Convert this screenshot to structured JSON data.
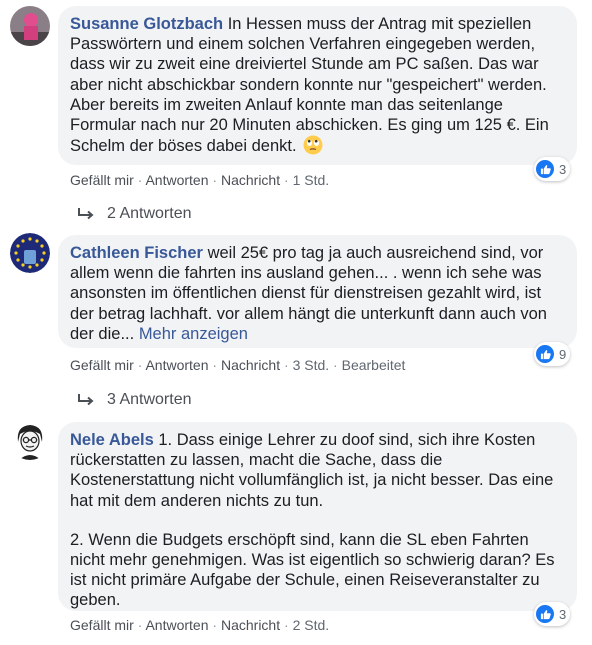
{
  "comments": [
    {
      "author": "Susanne Glotzbach",
      "text": "In Hessen muss der Antrag mit speziellen Passwörtern und einem solchen Verfahren eingegeben werden, dass wir zu zweit eine dreiviertel Stunde am PC saßen. Das war aber nicht abschickbar sondern konnte nur \"gespeichert\" werden. Aber bereits im zweiten Anlauf konnte man das seitenlange Formular nach nur 20 Minuten abschicken. Es ging um 125 €. Ein Schelm der böses dabei denkt.",
      "emoji": "eye-roll-emoji",
      "actions": {
        "like": "Gefällt mir",
        "reply": "Antworten",
        "message": "Nachricht",
        "time": "1 Std."
      },
      "reactions": {
        "icon": "like-icon",
        "count": "3"
      },
      "replies_label": "2 Antworten"
    },
    {
      "author": "Cathleen Fischer",
      "text": "weil 25€ pro tag ja auch ausreichend sind, vor allem wenn die fahrten ins ausland gehen... . wenn ich sehe was ansonsten im öffentlichen dienst für dienstreisen gezahlt wird, ist der betrag lachhaft. vor allem hängt die unterkunft dann auch von der die...",
      "more": "Mehr anzeigen",
      "actions": {
        "like": "Gefällt mir",
        "reply": "Antworten",
        "message": "Nachricht",
        "time": "3 Std.",
        "edited": "Bearbeitet"
      },
      "reactions": {
        "icon": "like-icon",
        "count": "9"
      },
      "replies_label": "3 Antworten"
    },
    {
      "author": "Nele Abels",
      "paragraphs": [
        "1. Dass einige Lehrer zu doof sind, sich ihre Kosten rückerstatten zu lassen, macht die Sache, dass die Kostenerstattung nicht vollumfänglich ist, ja nicht besser. Das eine hat mit dem anderen nichts zu tun.",
        "2. Wenn die Budgets erschöpft sind, kann die SL eben Fahrten nicht mehr genehmigen. Was ist eigentlich so schwierig daran? Es ist nicht primäre Aufgabe der Schule, einen Reiseveranstalter zu geben."
      ],
      "actions": {
        "like": "Gefällt mir",
        "reply": "Antworten",
        "message": "Nachricht",
        "time": "2 Std."
      },
      "reactions": {
        "icon": "like-icon",
        "count": "3"
      }
    }
  ],
  "separator": "·",
  "colors": {
    "author": "#385898",
    "bubble": "#f2f3f5",
    "like": "#1877f2",
    "meta": "#606770"
  }
}
